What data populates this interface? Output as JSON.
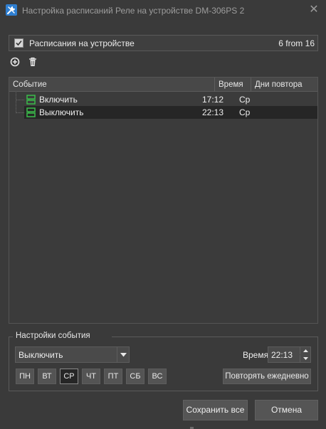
{
  "window": {
    "title": "Настройка расписаний Реле на устройстве DM-306PS 2",
    "app_icon": "tools-icon",
    "close_symbol": "✕"
  },
  "schedules": {
    "enabled_label": "Расписания на устройстве",
    "enabled": true,
    "count": "6 from 16"
  },
  "toolbar": {
    "add_icon": "add-circle-icon",
    "delete_icon": "trash-icon"
  },
  "table": {
    "columns": [
      "Событие",
      "Время",
      "Дни повтора"
    ],
    "rows": [
      {
        "event": "Включить",
        "time": "17:12",
        "days": "Ср",
        "selected": false
      },
      {
        "event": "Выключить",
        "time": "22:13",
        "days": "Ср",
        "selected": true
      }
    ]
  },
  "event_settings": {
    "title": "Настройки события",
    "action": "Выключить",
    "time_label": "Время",
    "time_value": "22:13",
    "days": [
      {
        "label": "ПН",
        "active": false
      },
      {
        "label": "ВТ",
        "active": false
      },
      {
        "label": "СР",
        "active": true
      },
      {
        "label": "ЧТ",
        "active": false
      },
      {
        "label": "ПТ",
        "active": false
      },
      {
        "label": "СБ",
        "active": false
      },
      {
        "label": "ВС",
        "active": false
      }
    ],
    "repeat_daily_label": "Повторять ежедневно"
  },
  "buttons": {
    "save_all": "Сохранить все",
    "cancel": "Отмена"
  },
  "colors": {
    "background": "#3a3a3a",
    "selected_row": "#262626",
    "event_icon": "#3bb54a",
    "app_icon": "#2f7fd1"
  }
}
